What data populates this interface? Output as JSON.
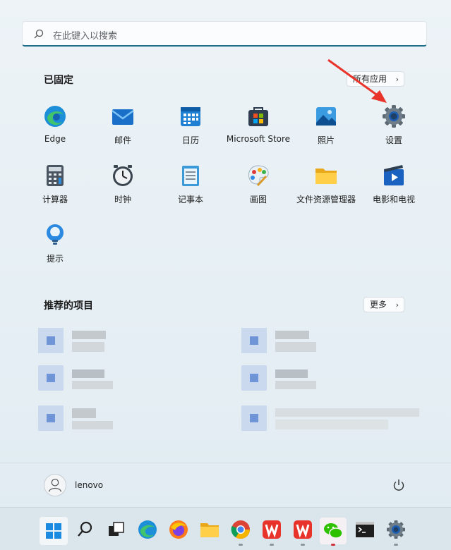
{
  "search": {
    "placeholder": "在此键入以搜索"
  },
  "pinned": {
    "title": "已固定",
    "all_apps": "所有应用",
    "apps": [
      {
        "label": "Edge",
        "icon": "edge-icon"
      },
      {
        "label": "邮件",
        "icon": "mail-icon"
      },
      {
        "label": "日历",
        "icon": "calendar-icon"
      },
      {
        "label": "Microsoft Store",
        "icon": "store-icon"
      },
      {
        "label": "照片",
        "icon": "photos-icon"
      },
      {
        "label": "设置",
        "icon": "settings-gear-icon"
      },
      {
        "label": "计算器",
        "icon": "calculator-icon"
      },
      {
        "label": "时钟",
        "icon": "clock-icon"
      },
      {
        "label": "记事本",
        "icon": "notepad-icon"
      },
      {
        "label": "画图",
        "icon": "paint-icon"
      },
      {
        "label": "文件资源管理器",
        "icon": "folder-icon"
      },
      {
        "label": "电影和电视",
        "icon": "movies-icon"
      },
      {
        "label": "提示",
        "icon": "tips-icon"
      }
    ]
  },
  "recommended": {
    "title": "推荐的项目",
    "more": "更多"
  },
  "user": {
    "name": "lenovo"
  },
  "taskbar": {
    "items": [
      "start-icon",
      "search-icon",
      "task-view-icon",
      "edge-icon",
      "firefox-icon",
      "folder-icon",
      "chrome-icon",
      "wps-icon",
      "wps-icon",
      "wechat-icon",
      "terminal-icon",
      "settings-gear-icon"
    ]
  },
  "colors": {
    "accent": "#1f6f8b",
    "arrow": "#e8342a"
  }
}
